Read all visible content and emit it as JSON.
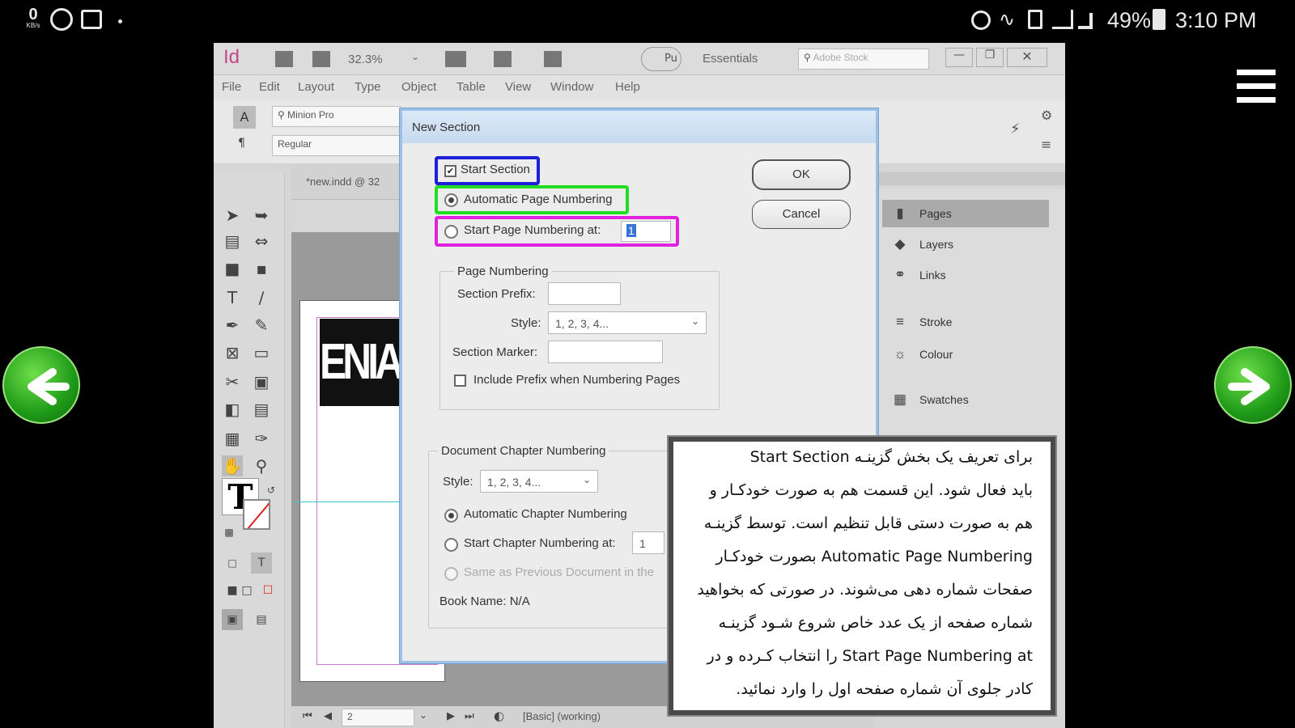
{
  "status_bar": {
    "time": "3:10 PM",
    "battery": "49%",
    "kbps_value": "0",
    "kbps_unit": "KB/s"
  },
  "app": {
    "logo": "Id",
    "zoom": "32.3%",
    "publish_label": "Pu",
    "workspace": "Essentials",
    "search_placeholder": "Adobe Stock",
    "menu": [
      "File",
      "Edit",
      "Layout",
      "Type",
      "Object",
      "Table",
      "View",
      "Window",
      "Help"
    ],
    "font_family": "Minion Pro",
    "font_style": "Regular",
    "doc_tab": "*new.indd @ 32",
    "page_field": "2",
    "preflight": "[Basic] (working)",
    "eniac_text": "ENIAC"
  },
  "panel": {
    "items": [
      {
        "label": "Pages",
        "icon": "pages-icon"
      },
      {
        "label": "Layers",
        "icon": "layers-icon"
      },
      {
        "label": "Links",
        "icon": "links-icon"
      },
      {
        "label": "Stroke",
        "icon": "stroke-icon"
      },
      {
        "label": "Colour",
        "icon": "colour-icon"
      },
      {
        "label": "Swatches",
        "icon": "swatches-icon"
      }
    ]
  },
  "dialog": {
    "title": "New Section",
    "start_section": "Start Section",
    "auto_page_numbering": "Automatic Page Numbering",
    "start_page_numbering": "Start Page Numbering at:",
    "start_page_value": "1",
    "ok": "OK",
    "cancel": "Cancel",
    "page_numbering_group": "Page Numbering",
    "section_prefix_label": "Section Prefix:",
    "style_label": "Style:",
    "style_value": "1, 2, 3, 4...",
    "section_marker_label": "Section Marker:",
    "include_prefix": "Include Prefix when Numbering Pages",
    "chapter_group": "Document Chapter Numbering",
    "chapter_style_label": "Style:",
    "chapter_style_value": "1, 2, 3, 4...",
    "auto_chapter": "Automatic Chapter Numbering",
    "start_chapter": "Start Chapter Numbering at:",
    "start_chapter_value": "1",
    "same_as_previous": "Same as Previous Document in the",
    "book_name": "Book Name: N/A"
  },
  "note": {
    "lines": [
      "برای تعریف یک بخش گزینـه Start Section",
      "باید فعال شود. این قسمت هم به صورت خودکـار و",
      "هم به صورت دستی قابل تنظیم است. توسط گزینـه",
      "Automatic Page Numbering بصورت خودکـار",
      "صفحات شماره دهی می‌شوند. در صورتی که بخواهید",
      "شماره صفحه از یک عدد خاص شروع شـود گزینـه",
      "Start Page Numbering at را انتخاب کـرده و در",
      "کادر جلوی آن شماره صفحه اول را وارد نمائید."
    ]
  },
  "colors": {
    "highlight_blue": "#1e1edb",
    "highlight_green": "#22dd22",
    "highlight_magenta": "#e021e0",
    "arrow_green": "#2eaa22"
  }
}
